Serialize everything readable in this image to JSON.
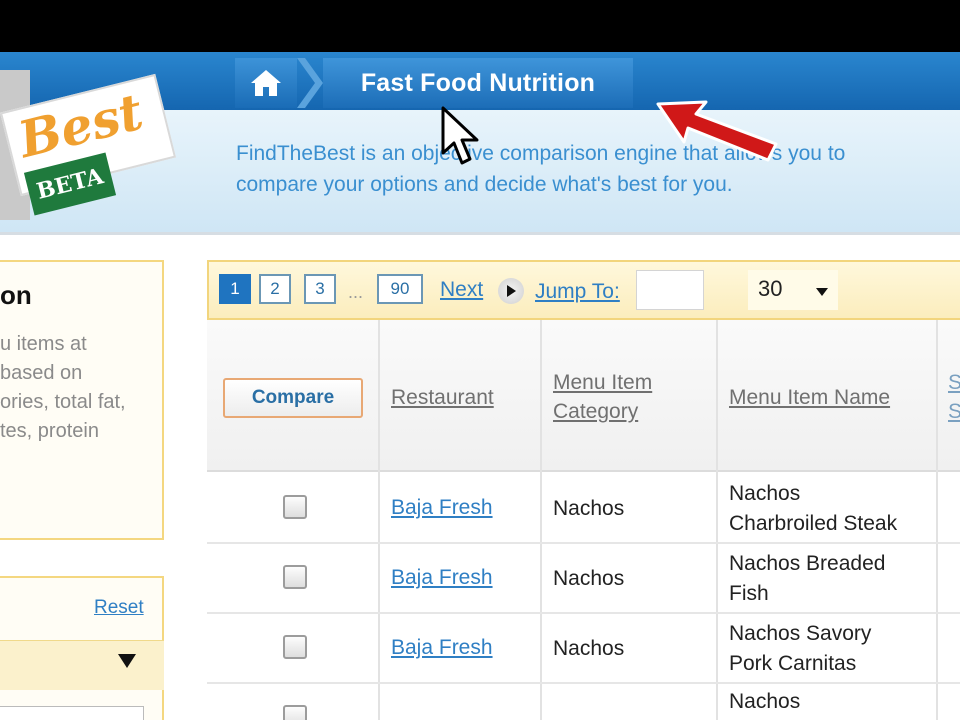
{
  "header": {
    "title": "Fast Food Nutrition",
    "description_line1": "FindTheBest is an objective comparison engine that allows you to",
    "description_line2": "compare your options and decide what's best for you."
  },
  "logo": {
    "word": "Best",
    "badge": "BETA"
  },
  "sidebar": {
    "info_title": "on",
    "info_lines": [
      "u items at",
      "based on",
      "ories, total fat,",
      "tes, protein"
    ],
    "reset_label": "Reset"
  },
  "pagination": {
    "pages": [
      "1",
      "2",
      "3"
    ],
    "ellipsis": "...",
    "last_page": "90",
    "next_label": "Next",
    "jump_label": "Jump To:",
    "per_page": "30"
  },
  "table": {
    "compare_label": "Compare",
    "headers": {
      "restaurant": "Restaurant",
      "category_line1": "Menu Item",
      "category_line2": "Category",
      "name": "Menu Item Name",
      "stub_line1": "S",
      "stub_line2": "S"
    },
    "rows": [
      {
        "restaurant": "Baja Fresh",
        "category": "Nachos",
        "name_line1": "Nachos",
        "name_line2": "Charbroiled Steak"
      },
      {
        "restaurant": "Baja Fresh",
        "category": "Nachos",
        "name_line1": "Nachos Breaded",
        "name_line2": "Fish"
      },
      {
        "restaurant": "Baja Fresh",
        "category": "Nachos",
        "name_line1": "Nachos Savory",
        "name_line2": "Pork Carnitas"
      },
      {
        "name_line1": "Nachos"
      }
    ]
  },
  "colors": {
    "nav_blue": "#1566b0",
    "link_blue": "#2f7fc4",
    "box_border": "#f2d57d",
    "arrow_red": "#d01818"
  },
  "icons": [
    "home-icon",
    "play-circle-icon",
    "dropdown-arrow-icon",
    "mouse-cursor-icon",
    "red-arrow-annotation"
  ]
}
